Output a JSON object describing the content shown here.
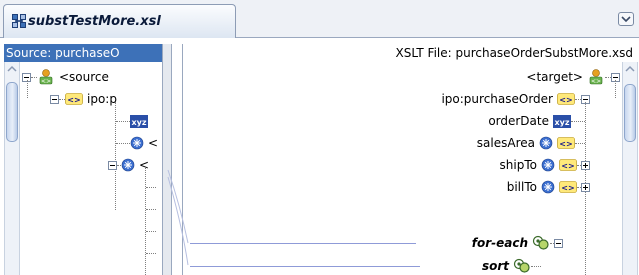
{
  "tab": {
    "title": "substTestMore.xsl",
    "icon": "xsl-map-icon"
  },
  "source": {
    "header": "Source: purchaseO",
    "rows": [
      {
        "label": "<source",
        "icon": "schema-icon"
      },
      {
        "label": "ipo:p",
        "icon": "element-icon"
      },
      {
        "label": "",
        "icon": "xyz-icon"
      },
      {
        "label": "<",
        "icon": "attribute-icon"
      },
      {
        "label": "<",
        "icon": "attribute-icon"
      }
    ]
  },
  "target": {
    "header": "XSLT File: purchaseOrderSubstMore.xsd",
    "rows": [
      {
        "label": "<target>",
        "icon": "schema-icon"
      },
      {
        "label": "ipo:purchaseOrder",
        "icon": "element-icon"
      },
      {
        "label": "orderDate",
        "icon": "xyz-icon"
      },
      {
        "label": "salesArea",
        "icon": "attribute-icon"
      },
      {
        "label": "shipTo",
        "icon": "attribute-icon"
      },
      {
        "label": "billTo",
        "icon": "attribute-icon"
      },
      {
        "label": "for-each",
        "icon": "xsl-component-icon"
      },
      {
        "label": "sort",
        "icon": "xsl-component-icon"
      }
    ]
  }
}
